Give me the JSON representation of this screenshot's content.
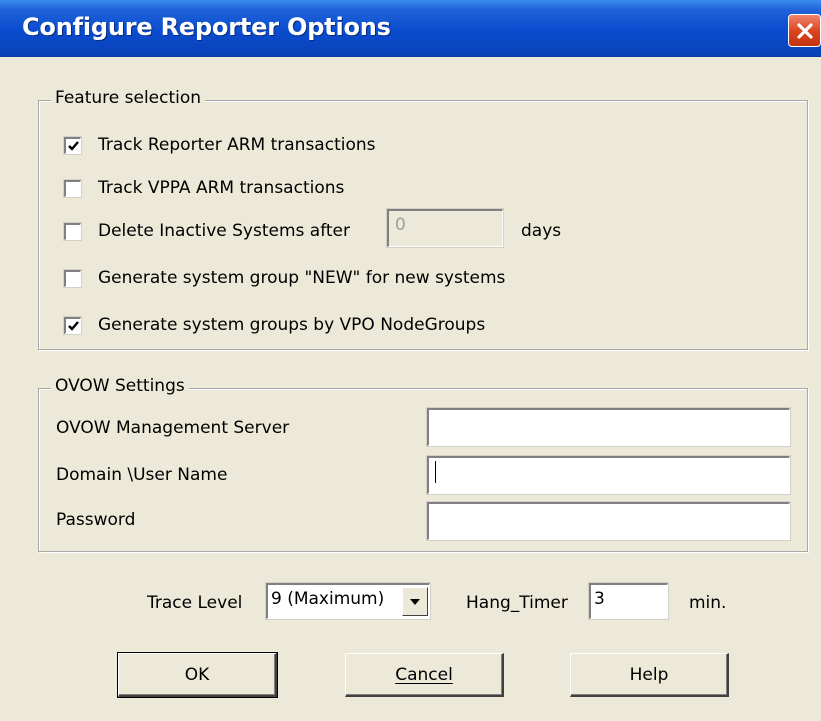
{
  "window": {
    "title": "Configure Reporter Options"
  },
  "feature_selection": {
    "legend": "Feature selection",
    "items": [
      {
        "label": "Track Reporter ARM transactions",
        "checked": true
      },
      {
        "label": "Track VPPA ARM transactions",
        "checked": false
      },
      {
        "label": "Delete Inactive Systems after",
        "checked": false
      },
      {
        "label": "Generate system group \"NEW\" for new systems",
        "checked": false
      },
      {
        "label": "Generate system groups by VPO NodeGroups",
        "checked": true
      }
    ],
    "inactive_days_value": "0",
    "days_label": "days"
  },
  "ovow": {
    "legend": "OVOW Settings",
    "server_label": "OVOW Management Server",
    "server_value": "",
    "user_label": "Domain \\User Name",
    "user_value": "",
    "password_label": "Password",
    "password_value": ""
  },
  "trace": {
    "label": "Trace Level",
    "selected": "9 (Maximum)"
  },
  "hang": {
    "label": "Hang_Timer",
    "value": "3",
    "unit": "min."
  },
  "buttons": {
    "ok": "OK",
    "cancel": "Cancel",
    "help": "Help"
  },
  "icons": {
    "close": "close-icon",
    "check": "checkmark-icon",
    "dropdown": "chevron-down-icon"
  },
  "colors": {
    "titlebar": "#0a4ccf",
    "close": "#d9421c",
    "face": "#ece9d8"
  }
}
